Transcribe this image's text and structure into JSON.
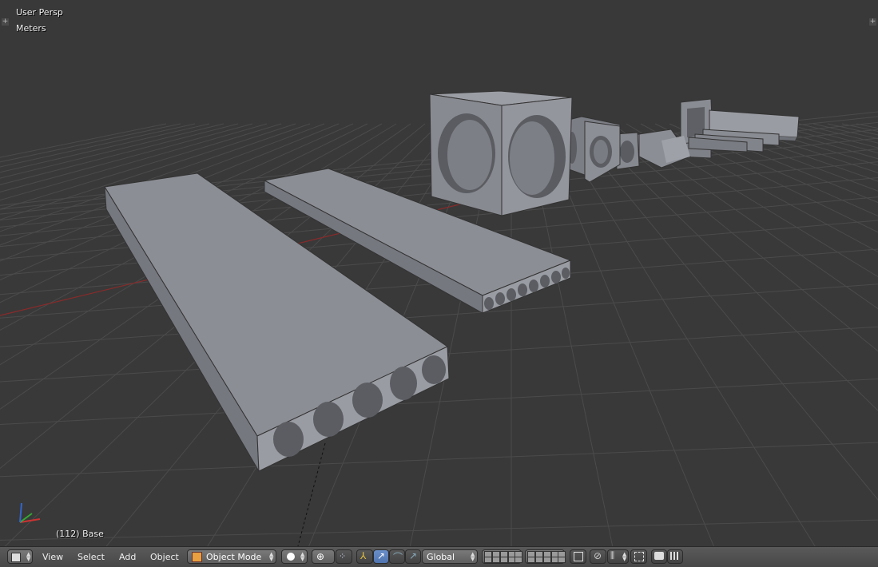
{
  "viewport": {
    "view_label": "User Persp",
    "units_label": "Meters",
    "object_info": "(112) Base"
  },
  "header": {
    "menus": {
      "view": "View",
      "select": "Select",
      "add": "Add",
      "object": "Object"
    },
    "mode": "Object Mode",
    "orientation": "Global"
  },
  "colors": {
    "background": "#393939",
    "grid": "#4b4b4b",
    "x_axis": "#8a2a2a",
    "mesh": "#8c8e95"
  }
}
